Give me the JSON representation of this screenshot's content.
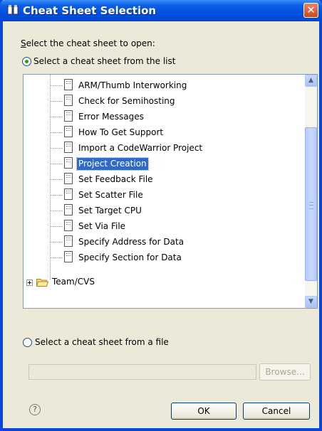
{
  "window": {
    "title": "Cheat Sheet Selection",
    "title_icon": "cheat-sheet-icon",
    "close_icon": "close-icon"
  },
  "dialog": {
    "prompt_underlined": "S",
    "prompt_rest": "elect the cheat sheet to open:",
    "option_list_label": "Select a cheat sheet from the list",
    "option_list_selected": true,
    "option_file_label": "Select a cheat sheet from a file",
    "option_file_selected": false,
    "file_path_value": "",
    "browse_label": "Browse...",
    "ok_label": "OK",
    "cancel_label": "Cancel",
    "help_icon": "help-icon",
    "help_glyph": "?"
  },
  "tree": {
    "items": [
      {
        "label": "ARM/Thumb Interworking",
        "icon": "document-icon"
      },
      {
        "label": "Check for Semihosting",
        "icon": "document-icon"
      },
      {
        "label": "Error Messages",
        "icon": "document-icon"
      },
      {
        "label": "How To Get Support",
        "icon": "document-icon"
      },
      {
        "label": "Import a CodeWarrior Project",
        "icon": "document-icon"
      },
      {
        "label": "Project Creation",
        "icon": "document-icon",
        "selected": true
      },
      {
        "label": "Set Feedback File",
        "icon": "document-icon"
      },
      {
        "label": "Set Scatter File",
        "icon": "document-icon"
      },
      {
        "label": "Set Target CPU",
        "icon": "document-icon"
      },
      {
        "label": "Set Via File",
        "icon": "document-icon"
      },
      {
        "label": "Specify Address for Data",
        "icon": "document-icon"
      },
      {
        "label": "Specify Section for Data",
        "icon": "document-icon"
      }
    ],
    "folder": {
      "label": "Team/CVS",
      "icon": "folder-icon",
      "expanded": false
    }
  },
  "colors": {
    "title_bar": "#0050e0",
    "selection": "#316ac5",
    "dialog_bg": "#ece9d8",
    "radio_dot": "#21a121"
  }
}
